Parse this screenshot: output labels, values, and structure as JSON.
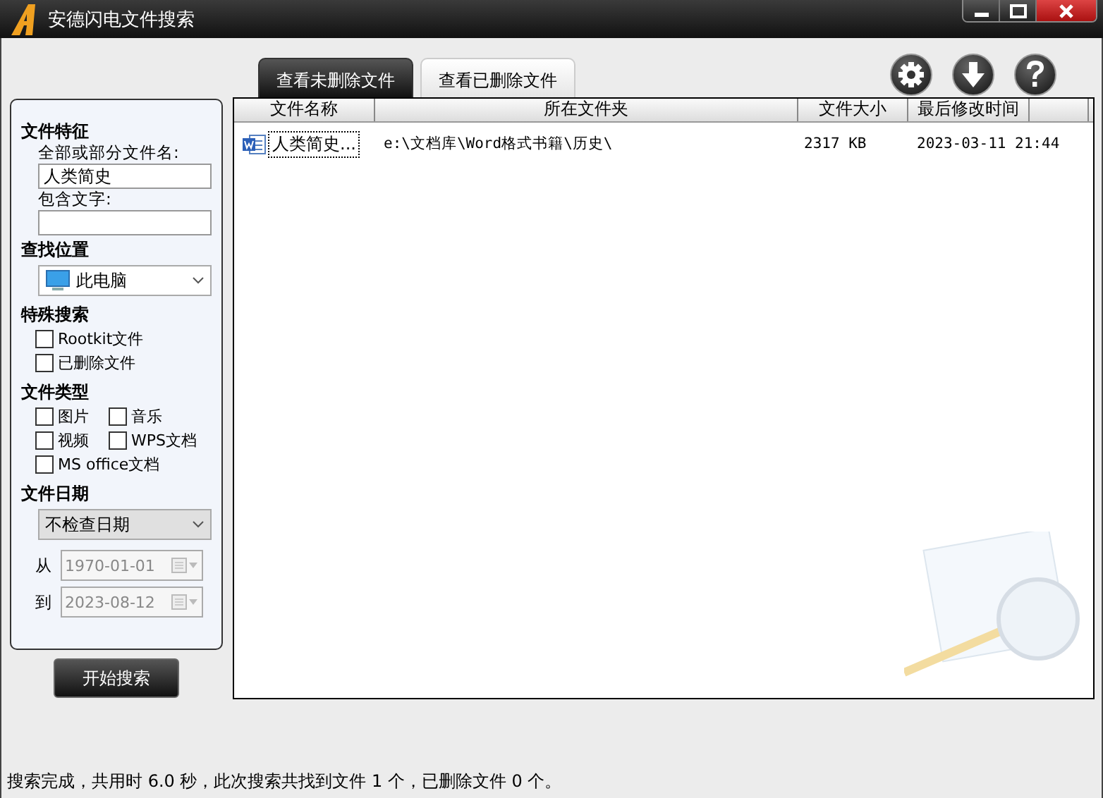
{
  "window": {
    "title": "安德闪电文件搜索"
  },
  "tabs": [
    {
      "label": "查看未删除文件",
      "selected": true
    },
    {
      "label": "查看已删除文件",
      "selected": false
    }
  ],
  "sidebar": {
    "file_features": {
      "heading": "文件特征",
      "name_label": "全部或部分文件名:",
      "name_value": "人类简史",
      "content_label": "包含文字:"
    },
    "location": {
      "heading": "查找位置",
      "value": "此电脑"
    },
    "special": {
      "heading": "特殊搜索",
      "options": [
        {
          "label": "Rootkit文件",
          "checked": false,
          "wide": true
        },
        {
          "label": "已删除文件",
          "checked": false,
          "wide": true
        }
      ]
    },
    "types": {
      "heading": "文件类型",
      "options": [
        {
          "label": "图片",
          "checked": false,
          "wide": false
        },
        {
          "label": "音乐",
          "checked": false,
          "wide": false
        },
        {
          "label": "视频",
          "checked": false,
          "wide": false
        },
        {
          "label": "WPS文档",
          "checked": false,
          "wide": false
        },
        {
          "label": "MS office文档",
          "checked": false,
          "wide": true
        }
      ]
    },
    "date": {
      "heading": "文件日期",
      "mode": "不检查日期",
      "from_label": "从",
      "from": "1970-01-01",
      "to_label": "到",
      "to": "2023-08-12",
      "disabled": true
    }
  },
  "search_button": "开始搜索",
  "table": {
    "columns": [
      "文件名称",
      "所在文件夹",
      "文件大小",
      "最后修改时间"
    ],
    "rows": [
      {
        "name": "人类简史...",
        "folder": "e:\\文档库\\Word格式书籍\\历史\\",
        "size": "2317 KB",
        "modified": "2023-03-11 21:44",
        "focused": true
      }
    ]
  },
  "status_bar": "搜索完成，共用时 6.0 秒，此次搜索共找到文件 1 个，已删除文件 0 个。"
}
